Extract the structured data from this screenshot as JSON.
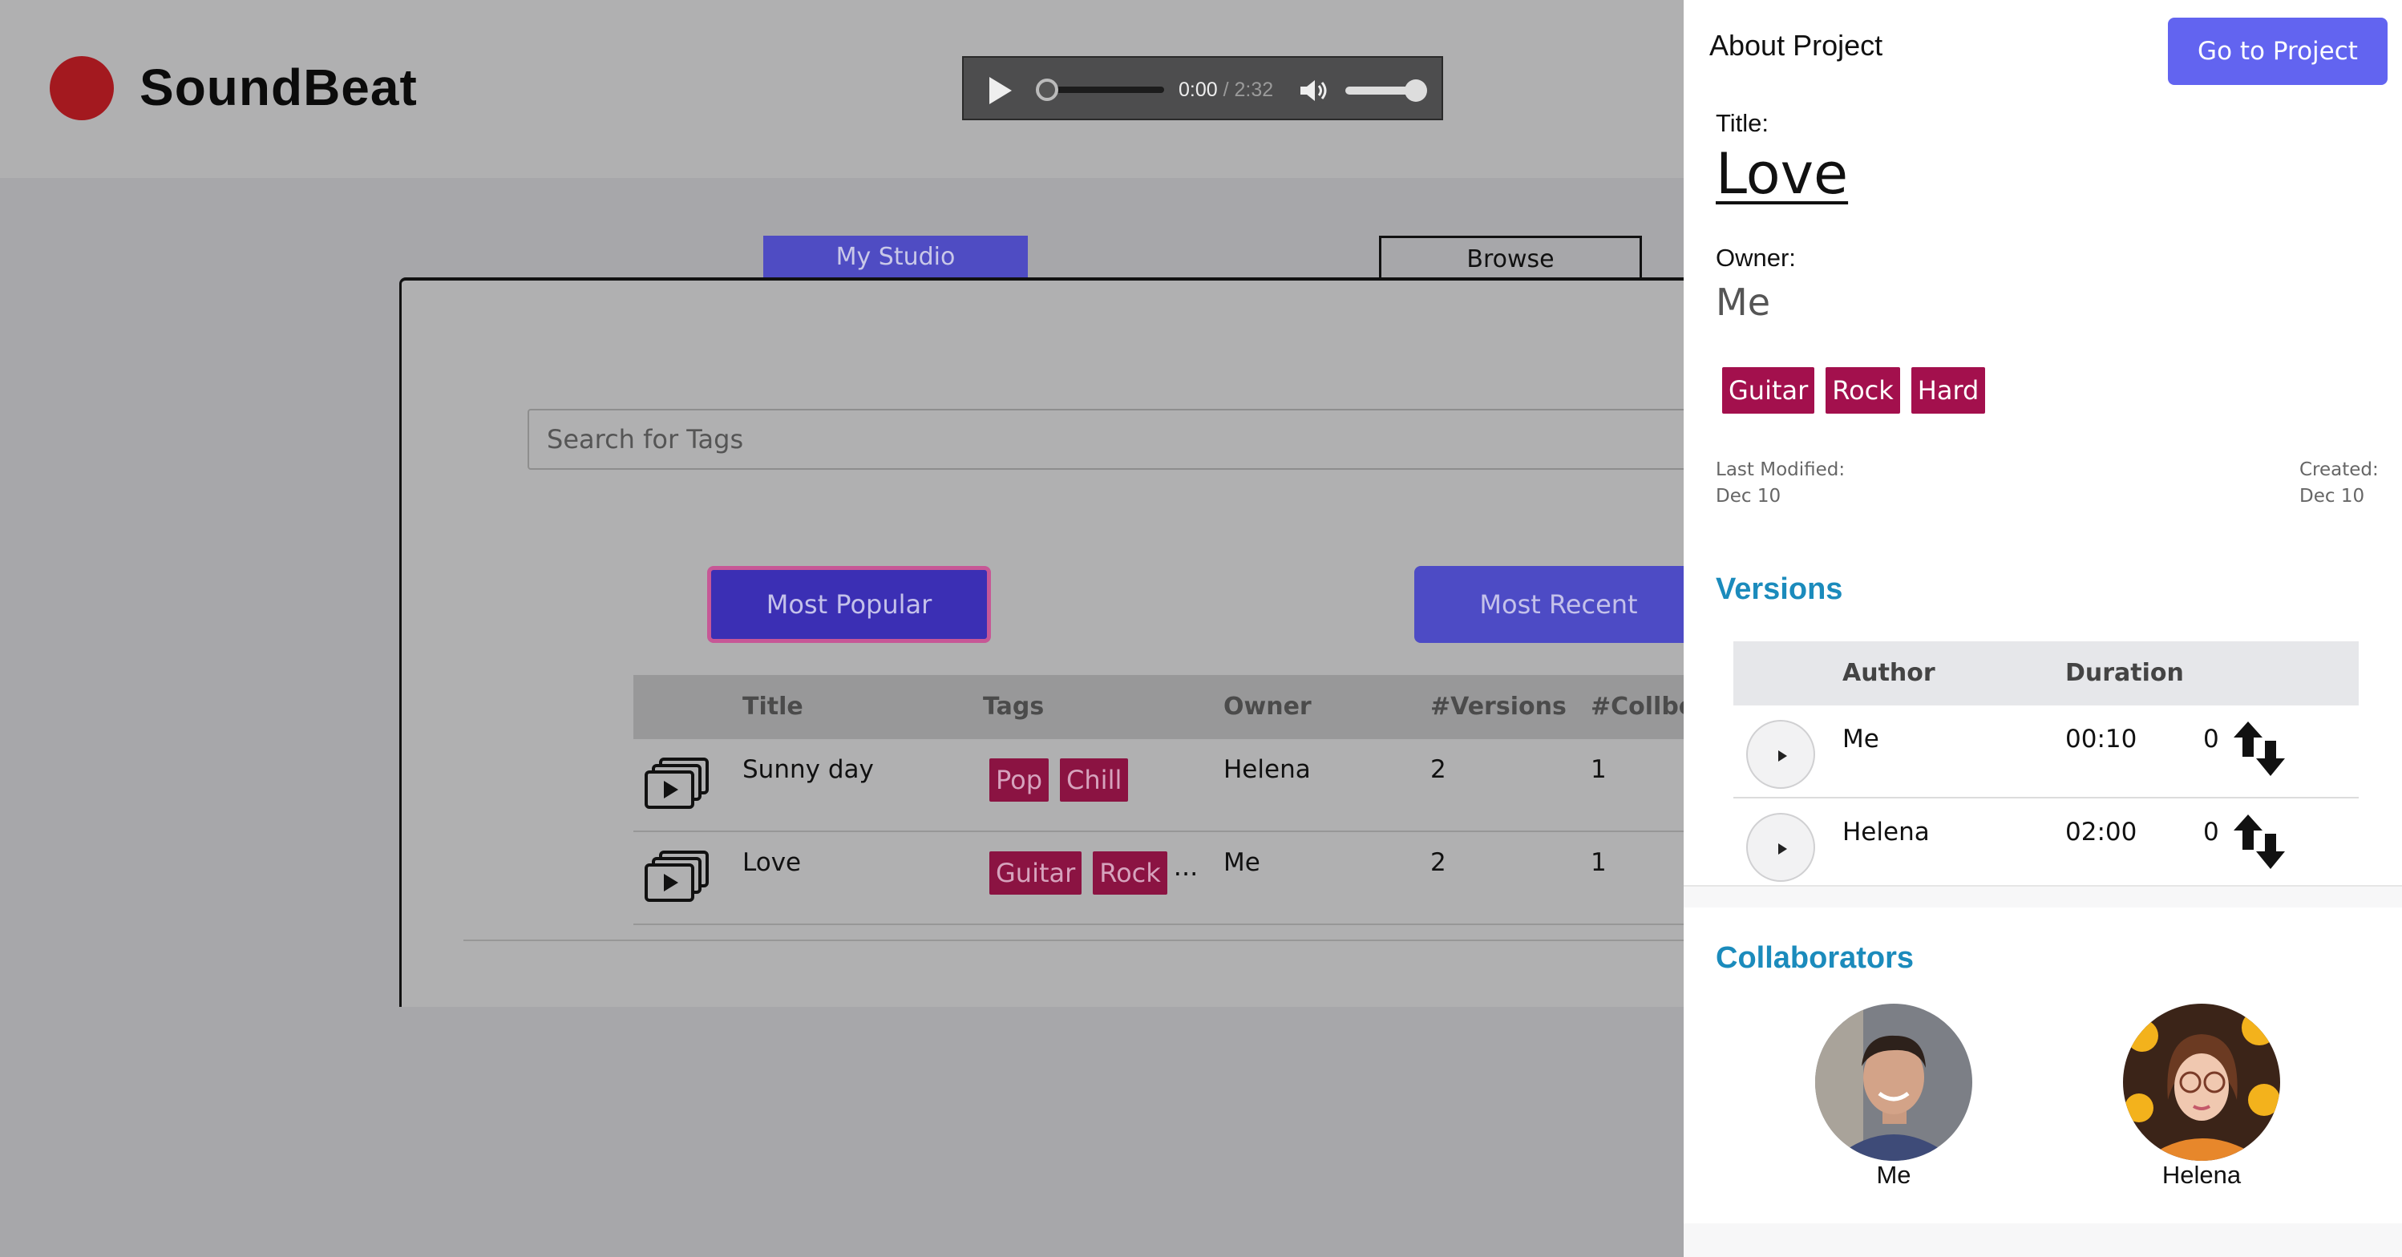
{
  "app": {
    "name": "SoundBeat"
  },
  "player": {
    "current": "0:00",
    "separator": " / ",
    "duration": "2:32",
    "progress": 0.0,
    "volume": 1.0
  },
  "tabs": [
    {
      "label": "My Studio",
      "active": true
    },
    {
      "label": "Browse",
      "active": false
    }
  ],
  "search": {
    "placeholder": "Search for Tags"
  },
  "sort": {
    "popular": "Most Popular",
    "recent": "Most Recent"
  },
  "table": {
    "headers": {
      "title": "Title",
      "tags": "Tags",
      "owner": "Owner",
      "versions": "#Versions",
      "collab": "#Collbo"
    },
    "rows": [
      {
        "title": "Sunny day",
        "tags": [
          "Pop",
          "Chill"
        ],
        "more": "",
        "owner": "Helena",
        "versions": "2",
        "collab": "1"
      },
      {
        "title": "Love",
        "tags": [
          "Guitar",
          "Rock"
        ],
        "more": "...",
        "owner": "Me",
        "versions": "2",
        "collab": "1"
      }
    ]
  },
  "side": {
    "heading": "About Project",
    "goto": "Go to Project",
    "title_label": "Title:",
    "title": "Love",
    "owner_label": "Owner:",
    "owner": "Me",
    "tags": [
      "Guitar",
      "Rock",
      "Hard"
    ],
    "modified_label": "Last Modified:",
    "modified": "Dec 10",
    "created_label": "Created:",
    "created": "Dec 10",
    "versions_heading": "Versions",
    "versions_headers": {
      "author": "Author",
      "duration": "Duration"
    },
    "versions": [
      {
        "author": "Me",
        "duration": "00:10",
        "count": "0"
      },
      {
        "author": "Helena",
        "duration": "02:00",
        "count": "0"
      }
    ],
    "collab_heading": "Collaborators",
    "collaborators": [
      {
        "name": "Me"
      },
      {
        "name": "Helena"
      }
    ]
  },
  "colors": {
    "accent": "#4f4cc3",
    "tag": "#8b1342",
    "section": "#1b8bbc",
    "logo": "#a3191f"
  },
  "icons": [
    "play-icon",
    "volume-icon",
    "film-icon",
    "swap-icon"
  ]
}
